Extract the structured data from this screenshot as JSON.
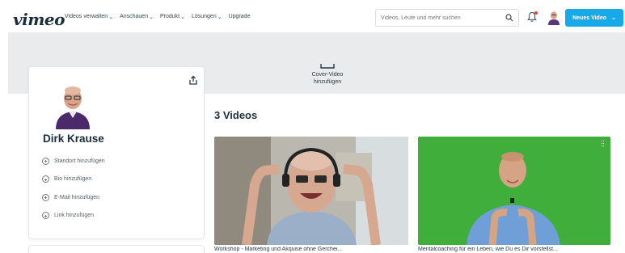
{
  "topbar": {
    "logo": "vimeo",
    "nav": [
      {
        "label": "Videos verwalten"
      },
      {
        "label": "Anschauen"
      },
      {
        "label": "Produkt"
      },
      {
        "label": "Lösungen"
      },
      {
        "label": "Upgrade"
      }
    ],
    "search_placeholder": "Videos, Leute und mehr suchen",
    "new_video_label": "Neues Video",
    "accent_color": "#17a9e8"
  },
  "cover": {
    "add_cover_label": "Cover-Video hinzufügen"
  },
  "profile": {
    "name": "Dirk Krause",
    "links": [
      {
        "label": "Standort hinzufügen"
      },
      {
        "label": "Bio hinzufügen"
      },
      {
        "label": "E-Mail hinzufügen"
      },
      {
        "label": "Link hinzufügen"
      }
    ]
  },
  "videos": {
    "count_label": "3 Videos",
    "items": [
      {
        "title": "Workshop - Marketing und Akquise ohne Gerchei..."
      },
      {
        "title": "Mentalcoaching für ein Leben, wie Du es Dir vorstellst..."
      }
    ]
  }
}
